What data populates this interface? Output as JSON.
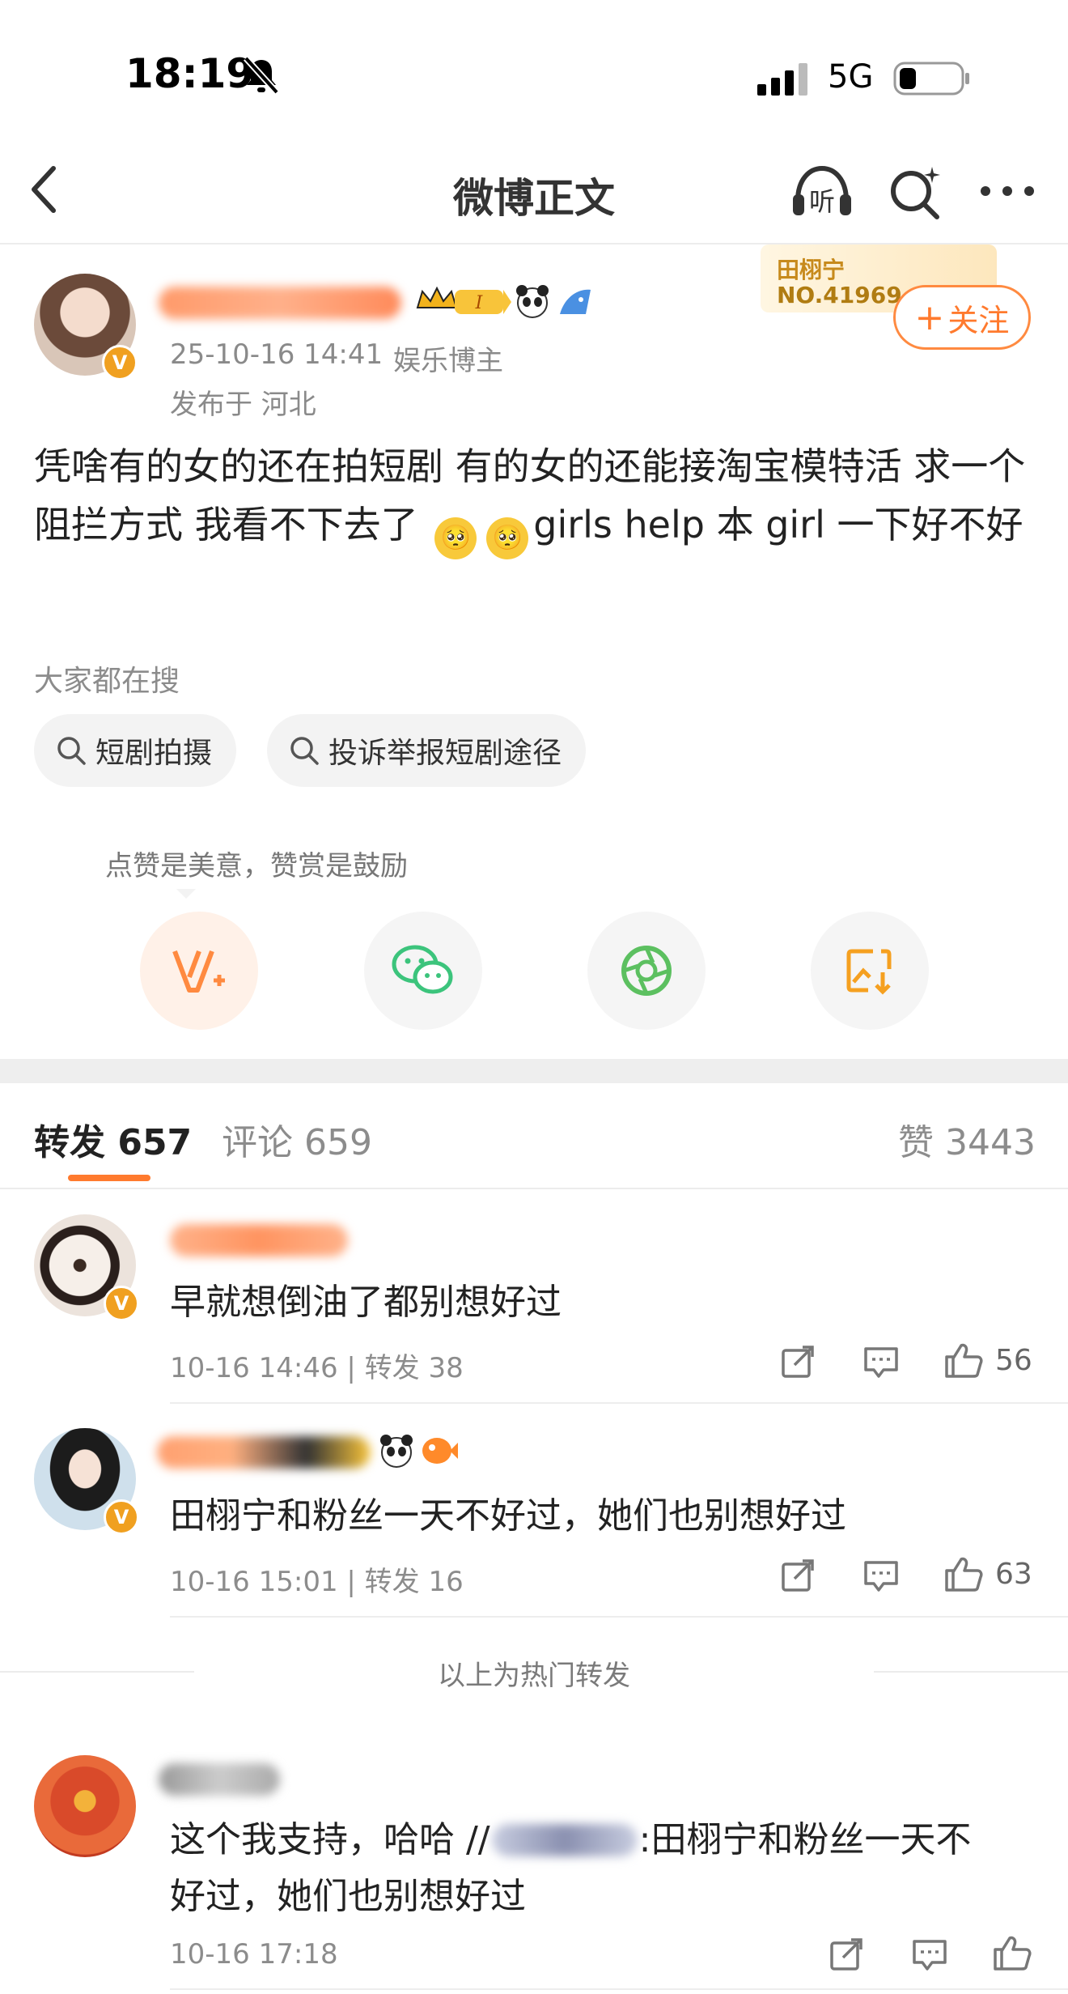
{
  "status_bar": {
    "time": "18:19",
    "network": "5G"
  },
  "nav": {
    "title": "微博正文"
  },
  "post": {
    "date": "25-10-16 14:41",
    "role": "娱乐博主",
    "location": "发布于 河北",
    "text": "凭啥有的女的还在拍短剧 有的女的还能接淘宝模特活 求一个阻拦方式 我看不下去了",
    "text_tail": "girls help 本 girl 一下好不好",
    "card_name": "田栩宁",
    "card_no": "NO.41969",
    "follow_label": "关注"
  },
  "search": {
    "label": "大家都在搜",
    "chips": [
      "短剧拍摄",
      "投诉举报短剧途径"
    ]
  },
  "reward_hint": "点赞是美意，赞赏是鼓励",
  "tabs": {
    "repost": "转发",
    "repost_count": "657",
    "comment": "评论",
    "comment_count": "659",
    "like": "赞",
    "like_count": "3443"
  },
  "reposts": [
    {
      "text": "早就想倒油了都别想好过",
      "meta": "10-16 14:46 | 转发 38",
      "likes": "56"
    },
    {
      "text": "田栩宁和粉丝一天不好过，她们也别想好过",
      "meta": "10-16 15:01 | 转发 16",
      "likes": "63"
    },
    {
      "text": "这个我支持，哈哈 // :田栩宁和粉丝一天不好过，她们也别想好过",
      "text_line1": "这个我支持，哈哈 //",
      "text_line1b": ":田栩宁和粉丝一天不",
      "text_line2": "好过，她们也别想好过",
      "meta": "10-16 17:18",
      "likes": ""
    }
  ],
  "hot_divider": "以上为热门转发",
  "colors": {
    "accent": "#ff7a2e",
    "verified": "#f0a020",
    "wechat": "#3cc47c"
  }
}
